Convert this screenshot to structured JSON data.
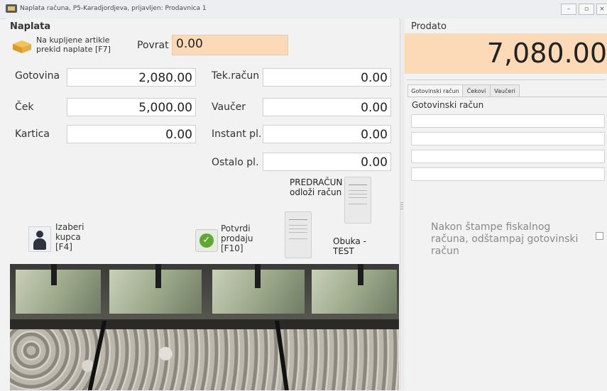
{
  "window": {
    "title": "Naplata računa, P5-Karadjordjeva, prijavljen: Prodavnica 1",
    "min_icon": "minimize-icon",
    "max_icon": "maximize-icon",
    "close_icon": "close-icon"
  },
  "payment": {
    "section_title": "Naplata",
    "refund_button": "Na kupljene artikle prekid naplate [F7]",
    "refund_label": "Povrat",
    "refund_value": "0.00",
    "fields": {
      "gotovina": {
        "label": "Gotovina",
        "value": "2,080.00"
      },
      "cek": {
        "label": "Ček",
        "value": "5,000.00"
      },
      "kartica": {
        "label": "Kartica",
        "value": "0.00"
      },
      "tekracun": {
        "label": "Tek.račun",
        "value": "0.00"
      },
      "vaucer": {
        "label": "Vaučer",
        "value": "0.00"
      },
      "instant": {
        "label": "Instant pl.",
        "value": "0.00"
      },
      "ostalo": {
        "label": "Ostalo pl.",
        "value": "0.00"
      }
    },
    "predracun_label": "PREDRAČUN odloži račun",
    "obuka_label": "Obuka - TEST",
    "customer_button": "Izaberi kupca [F4]",
    "confirm_button": "Potvrdi prodaju [F10]"
  },
  "summary": {
    "sold_label": "Prodato",
    "sold_value": "7,080.00",
    "tabs": [
      "Gotovinski račun",
      "Čekovi",
      "Vaučeri"
    ],
    "receipt_title": "Gotovinski račun",
    "note": "Nakon štampe fiskalnog računa, odštampaj gotovinski račun"
  },
  "colors": {
    "accent_orange": "#fcd9b7",
    "confirm_green": "#5fa832"
  }
}
